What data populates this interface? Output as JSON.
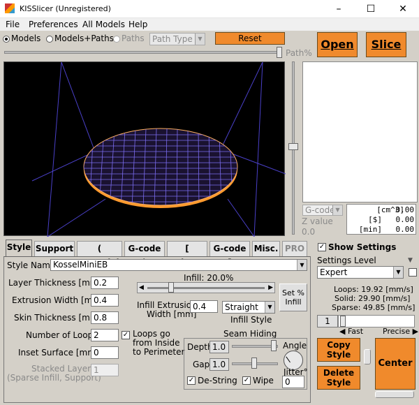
{
  "window": {
    "title": "KISSlicer (Unregistered)"
  },
  "menu": [
    "File",
    "Preferences",
    "All Models",
    "Help"
  ],
  "toolbar": {
    "view_modes": [
      "Models",
      "Models+Paths",
      "Paths"
    ],
    "path_type": "Path Type",
    "reset_label": "Reset",
    "open_label": "Open",
    "slice_label": "Slice",
    "path_pct_label": "Path%"
  },
  "stats": {
    "gcode_label": "G-code",
    "z_label": "Z value",
    "z_value": "0.0",
    "rows": [
      {
        "unit": "[cm^3]",
        "value": "0.00"
      },
      {
        "unit": "[$]",
        "value": "0.00"
      },
      {
        "unit": "[min]",
        "value": "0.00"
      }
    ]
  },
  "tabs": [
    "Style",
    "Support",
    "( Material",
    "G-code )",
    "[ Printer",
    "G-code ]",
    "Misc.",
    "PRO"
  ],
  "style": {
    "style_name_label": "Style Name",
    "style_name": "KosselMiniEB",
    "layer_thickness_label": "Layer Thickness [mm]",
    "layer_thickness": "0.2",
    "extrusion_width_label": "Extrusion Width [mm]",
    "extrusion_width": "0.4",
    "skin_thickness_label": "Skin Thickness [mm]",
    "skin_thickness": "0.8",
    "loops_label": "Number of Loops",
    "loops": "2",
    "loops_inside_label_1": "Loops go",
    "loops_inside_label_2": "from Inside",
    "loops_inside_label_3": "to Perimeter",
    "inset_label": "Inset  Surface [mm]",
    "inset": "0",
    "stacked_label_1": "Stacked Layers",
    "stacked_label_2": "(Sparse Infill, Support)",
    "stacked": "1",
    "infill_label": "Infill: 20.0%",
    "infill_fraction": 0.2,
    "set_infill_label_1": "Set %",
    "set_infill_label_2": "Infill",
    "infill_width_label_1": "Infill Extrusion",
    "infill_width_label_2": "Width [mm]",
    "infill_width": "0.4",
    "infill_style": "Straight",
    "infill_style_label": "Infill Style",
    "seam_title": "Seam Hiding",
    "depth_label": "Depth",
    "depth": "1.0",
    "gap_label": "Gap",
    "gap": "1.0",
    "angle_label": "Angle",
    "jitter_label": "Jitter°",
    "jitter": "0",
    "destring_label": "De-String",
    "wipe_label": "Wipe"
  },
  "right": {
    "show_settings": "Show Settings",
    "settings_level_label": "Settings Level",
    "settings_level": "Expert",
    "loops_speed": "Loops:  19.92 [mm/s]",
    "solid_speed": "Solid:  29.90 [mm/s]",
    "sparse_speed": "Sparse:  49.85 [mm/s]",
    "quality": "1",
    "fast_label": "Fast",
    "precise_label": "Precise",
    "copy_style": "Copy Style",
    "delete_style": "Delete Style",
    "center": "Center"
  },
  "colors": {
    "accent": "#f08a2c",
    "viewport": "#000000",
    "grid": "#6a5ad8",
    "disc_edge": "#ff9a2e"
  }
}
